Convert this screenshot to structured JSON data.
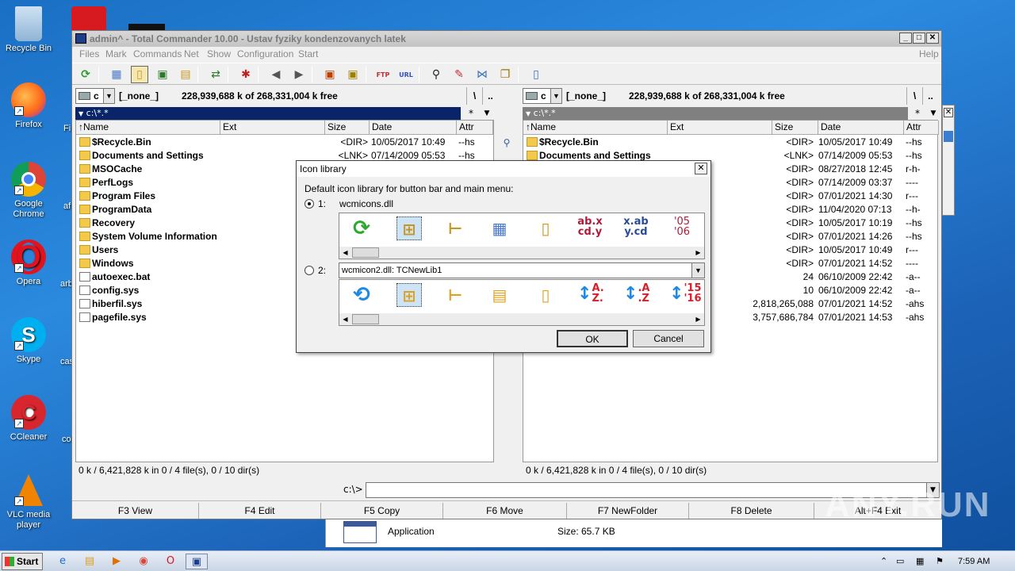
{
  "desktop": {
    "icons": [
      {
        "label": "Recycle Bin",
        "icon": "recycle-bin-icon"
      },
      {
        "label": "Firefox",
        "icon": "firefox-icon"
      },
      {
        "label": "Google Chrome",
        "icon": "chrome-icon"
      },
      {
        "label": "Opera",
        "icon": "opera-icon"
      },
      {
        "label": "Skype",
        "icon": "skype-icon"
      },
      {
        "label": "CCleaner",
        "icon": "ccleaner-icon"
      },
      {
        "label": "VLC media player",
        "icon": "vlc-icon"
      }
    ],
    "partial_labels": [
      "Fi",
      "af",
      "arb",
      "cas",
      "co"
    ]
  },
  "tc": {
    "title": "admin^ - Total Commander 10.00 - Ustav fyziky kondenzovanych latek",
    "menu": [
      "Files",
      "Mark",
      "Commands",
      "Net",
      "Show",
      "Configuration",
      "Start",
      "Help"
    ],
    "left": {
      "drive": "c",
      "volume": "[_none_]",
      "free": "228,939,688 k of 268,331,004 k free",
      "path": "c:\\*.*",
      "root_btn": "\\",
      "up_btn": "..",
      "columns": [
        "Name",
        "Ext",
        "Size",
        "Date",
        "Attr"
      ],
      "rows": [
        {
          "name": "$Recycle.Bin",
          "size": "<DIR>",
          "date": "10/05/2017 10:49",
          "attr": "--hs",
          "dir": true
        },
        {
          "name": "Documents and Settings",
          "size": "<LNK>",
          "date": "07/14/2009 05:53",
          "attr": "--hs",
          "dir": true
        },
        {
          "name": "MSOCache",
          "size": "",
          "date": "",
          "attr": "",
          "dir": true
        },
        {
          "name": "PerfLogs",
          "size": "",
          "date": "",
          "attr": "",
          "dir": true
        },
        {
          "name": "Program Files",
          "size": "",
          "date": "",
          "attr": "",
          "dir": true
        },
        {
          "name": "ProgramData",
          "size": "",
          "date": "",
          "attr": "",
          "dir": true
        },
        {
          "name": "Recovery",
          "size": "",
          "date": "",
          "attr": "",
          "dir": true
        },
        {
          "name": "System Volume Information",
          "size": "",
          "date": "",
          "attr": "",
          "dir": true
        },
        {
          "name": "Users",
          "size": "",
          "date": "",
          "attr": "",
          "dir": true
        },
        {
          "name": "Windows",
          "size": "",
          "date": "",
          "attr": "",
          "dir": true
        },
        {
          "name": "autoexec.bat",
          "size": "",
          "date": "",
          "attr": "",
          "dir": false
        },
        {
          "name": "config.sys",
          "size": "",
          "date": "",
          "attr": "",
          "dir": false
        },
        {
          "name": "hiberfil.sys",
          "size": "",
          "date": "",
          "attr": "",
          "dir": false
        },
        {
          "name": "pagefile.sys",
          "size": "",
          "date": "",
          "attr": "",
          "dir": false
        }
      ],
      "status": "0 k / 6,421,828 k in 0 / 4 file(s), 0 / 10 dir(s)"
    },
    "right": {
      "drive": "c",
      "volume": "[_none_]",
      "free": "228,939,688 k of 268,331,004 k free",
      "path": "c:\\*.*",
      "root_btn": "\\",
      "up_btn": "..",
      "columns": [
        "Name",
        "Ext",
        "Size",
        "Date",
        "Attr"
      ],
      "rows": [
        {
          "name": "$Recycle.Bin",
          "size": "<DIR>",
          "date": "10/05/2017 10:49",
          "attr": "--hs",
          "dir": true
        },
        {
          "name": "Documents and Settings",
          "size": "<LNK>",
          "date": "07/14/2009 05:53",
          "attr": "--hs",
          "dir": true
        },
        {
          "name": "",
          "size": "<DIR>",
          "date": "08/27/2018 12:45",
          "attr": "r-h-",
          "dir": true
        },
        {
          "name": "",
          "size": "<DIR>",
          "date": "07/14/2009 03:37",
          "attr": "----",
          "dir": true
        },
        {
          "name": "",
          "size": "<DIR>",
          "date": "07/01/2021 14:30",
          "attr": "r---",
          "dir": true
        },
        {
          "name": "",
          "size": "<DIR>",
          "date": "11/04/2020 07:13",
          "attr": "--h-",
          "dir": true
        },
        {
          "name": "",
          "size": "<DIR>",
          "date": "10/05/2017 10:19",
          "attr": "--hs",
          "dir": true
        },
        {
          "name": "",
          "size": "<DIR>",
          "date": "07/01/2021 14:26",
          "attr": "--hs",
          "dir": true
        },
        {
          "name": "",
          "size": "<DIR>",
          "date": "10/05/2017 10:49",
          "attr": "r---",
          "dir": true
        },
        {
          "name": "",
          "size": "<DIR>",
          "date": "07/01/2021 14:52",
          "attr": "----",
          "dir": true
        },
        {
          "name": "",
          "size": "24",
          "date": "06/10/2009 22:42",
          "attr": "-a--",
          "dir": false
        },
        {
          "name": "",
          "size": "10",
          "date": "06/10/2009 22:42",
          "attr": "-a--",
          "dir": false
        },
        {
          "name": "",
          "size": "2,818,265,088",
          "date": "07/01/2021 14:52",
          "attr": "-ahs",
          "dir": false
        },
        {
          "name": "",
          "size": "3,757,686,784",
          "date": "07/01/2021 14:53",
          "attr": "-ahs",
          "dir": false
        }
      ],
      "status": "0 k / 6,421,828 k in 0 / 4 file(s), 0 / 10 dir(s)"
    },
    "cmd_prompt": "c:\\>",
    "fkeys": [
      "F3 View",
      "F4 Edit",
      "F5 Copy",
      "F6 Move",
      "F7 NewFolder",
      "F8 Delete",
      "Alt+F4 Exit"
    ]
  },
  "dialog": {
    "title": "Icon library",
    "description": "Default icon library for button bar and main menu:",
    "option1_label": "1:",
    "option1_file": "wcmicons.dll",
    "option2_label": "2:",
    "option2_file": "wcmicon2.dll: TCNewLib1",
    "lib1_texts": [
      "ab.x\ncd.y",
      "x.ab\ny.cd",
      "'05\n'06"
    ],
    "lib2_texts": [
      "A.\nZ.",
      ".A\n.Z",
      "'15\n'16"
    ],
    "ok": "OK",
    "cancel": "Cancel"
  },
  "bgwin": {
    "type": "Application",
    "size": "Size: 65.7 KB"
  },
  "taskbar": {
    "start": "Start",
    "time": "7:59 AM"
  },
  "watermark": "ANY.RUN"
}
